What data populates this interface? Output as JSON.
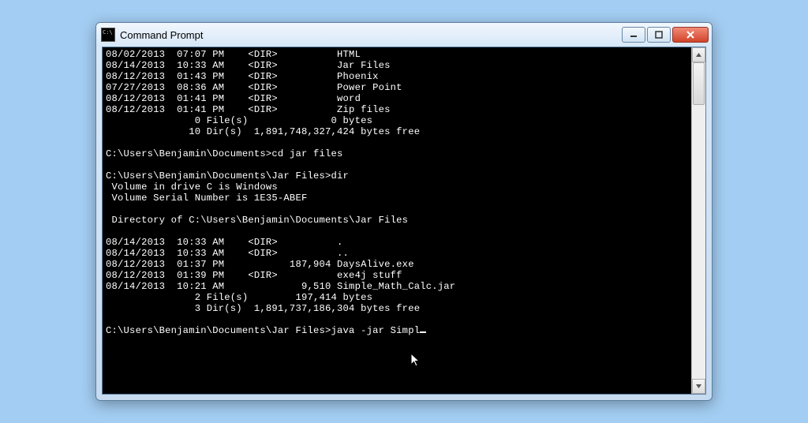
{
  "window": {
    "title": "Command Prompt"
  },
  "dir_top": [
    {
      "date": "08/02/2013",
      "time": "07:07 PM",
      "dir": "<DIR>",
      "size": "",
      "name": "HTML"
    },
    {
      "date": "08/14/2013",
      "time": "10:33 AM",
      "dir": "<DIR>",
      "size": "",
      "name": "Jar Files"
    },
    {
      "date": "08/12/2013",
      "time": "01:43 PM",
      "dir": "<DIR>",
      "size": "",
      "name": "Phoenix"
    },
    {
      "date": "07/27/2013",
      "time": "08:36 AM",
      "dir": "<DIR>",
      "size": "",
      "name": "Power Point"
    },
    {
      "date": "08/12/2013",
      "time": "01:41 PM",
      "dir": "<DIR>",
      "size": "",
      "name": "word"
    },
    {
      "date": "08/12/2013",
      "time": "01:41 PM",
      "dir": "<DIR>",
      "size": "",
      "name": "Zip files"
    }
  ],
  "summary_top": {
    "files": "               0 File(s)              0 bytes",
    "dirs": "              10 Dir(s)  1,891,748,327,424 bytes free"
  },
  "cmd1": {
    "prompt": "C:\\Users\\Benjamin\\Documents>",
    "cmd": "cd jar files"
  },
  "cmd2": {
    "prompt": "C:\\Users\\Benjamin\\Documents\\Jar Files>",
    "cmd": "dir"
  },
  "vol1": " Volume in drive C is Windows",
  "vol2": " Volume Serial Number is 1E35-ABEF",
  "dirof": " Directory of C:\\Users\\Benjamin\\Documents\\Jar Files",
  "dir_bot": [
    {
      "date": "08/14/2013",
      "time": "10:33 AM",
      "dir": "<DIR>",
      "size": "",
      "name": "."
    },
    {
      "date": "08/14/2013",
      "time": "10:33 AM",
      "dir": "<DIR>",
      "size": "",
      "name": ".."
    },
    {
      "date": "08/12/2013",
      "time": "01:37 PM",
      "dir": "",
      "size": "187,904",
      "name": "DaysAlive.exe"
    },
    {
      "date": "08/12/2013",
      "time": "01:39 PM",
      "dir": "<DIR>",
      "size": "",
      "name": "exe4j stuff"
    },
    {
      "date": "08/14/2013",
      "time": "10:21 AM",
      "dir": "",
      "size": "9,510",
      "name": "Simple_Math_Calc.jar"
    }
  ],
  "summary_bot": {
    "files": "               2 File(s)        197,414 bytes",
    "dirs": "               3 Dir(s)  1,891,737,186,304 bytes free"
  },
  "cmd3": {
    "prompt": "C:\\Users\\Benjamin\\Documents\\Jar Files>",
    "cmd": "java -jar Simpl"
  }
}
